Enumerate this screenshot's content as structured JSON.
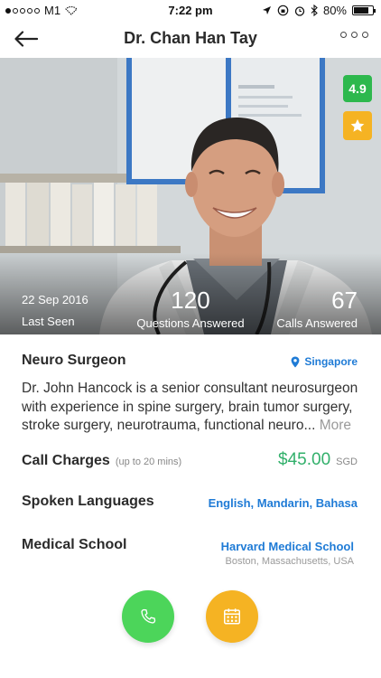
{
  "status_bar": {
    "carrier": "M1",
    "time": "7:22 pm",
    "battery": "80%",
    "battery_level": 0.8
  },
  "nav": {
    "title": "Dr. Chan Han Tay",
    "back_icon": "arrow-left-icon",
    "more_icon": "more-horizontal-icon"
  },
  "hero": {
    "rating": "4.9",
    "favorite_icon": "star-icon",
    "last_seen_date": "22 Sep 2016",
    "last_seen_label": "Last Seen",
    "questions_count": "120",
    "questions_label": "Questions Answered",
    "calls_count": "67",
    "calls_label": "Calls Answered"
  },
  "profile": {
    "specialty": "Neuro Surgeon",
    "location": "Singapore",
    "bio": "Dr. John Hancock is a senior consultant neurosurgeon with experience in spine surgery, brain tumor surgery, stroke surgery, neurotrauma, functional neuro...",
    "bio_more": "More",
    "call_charges_label": "Call Charges",
    "call_charges_note": "(up to 20 mins)",
    "price": "$45.00",
    "currency": "SGD",
    "languages_label": "Spoken Languages",
    "languages": "English, Mandarin, Bahasa",
    "school_label": "Medical School",
    "school": "Harvard Medical School",
    "school_location": "Boston, Massachusetts, USA"
  },
  "actions": {
    "call_icon": "phone-icon",
    "calendar_icon": "calendar-icon"
  },
  "colors": {
    "accent_blue": "#1f7bd6",
    "price_green": "#32b06b",
    "rating_green": "#2db84d",
    "star_yellow": "#f5b323",
    "call_green": "#4cd55a"
  }
}
